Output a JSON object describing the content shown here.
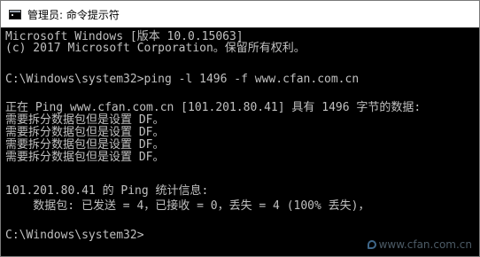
{
  "window": {
    "title": "管理员: 命令提示符",
    "icon": "console-icon"
  },
  "console": {
    "lines": [
      "Microsoft Windows [版本 10.0.15063]",
      "(c) 2017 Microsoft Corporation。保留所有权利。",
      "",
      "C:\\Windows\\system32>ping -l 1496 -f www.cfan.com.cn",
      "",
      "正在 Ping www.cfan.com.cn [101.201.80.41] 具有 1496 字节的数据:",
      "需要拆分数据包但是设置 DF。",
      "需要拆分数据包但是设置 DF。",
      "需要拆分数据包但是设置 DF。",
      "需要拆分数据包但是设置 DF。",
      "",
      "101.201.80.41 的 Ping 统计信息:",
      "    数据包: 已发送 = 4，已接收 = 0，丢失 = 4 (100% 丢失)，",
      "",
      "C:\\Windows\\system32>"
    ]
  },
  "watermark": {
    "text": "www.cfan.com.cn"
  },
  "colors": {
    "console_bg": "#000000",
    "console_text": "#c0c0c0",
    "titlebar_bg": "#ffffff"
  }
}
